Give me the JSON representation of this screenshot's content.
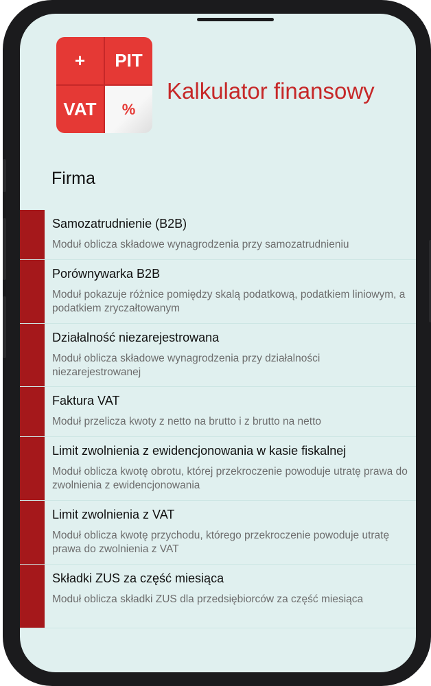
{
  "app": {
    "title": "Kalkulator finansowy",
    "logo": {
      "top_left": "+",
      "top_right": "PIT",
      "bottom_left": "VAT",
      "bottom_right": "%"
    }
  },
  "section": {
    "title": "Firma"
  },
  "items": [
    {
      "title": "Samozatrudnienie (B2B)",
      "description": "Moduł oblicza składowe wynagrodzenia przy samozatrudnieniu"
    },
    {
      "title": "Porównywarka B2B",
      "description": "Moduł pokazuje różnice pomiędzy skalą podatkową, podatkiem liniowym, a podatkiem zryczałtowanym"
    },
    {
      "title": "Działalność niezarejestrowana",
      "description": "Moduł oblicza składowe wynagrodzenia przy działalności niezarejestrowanej"
    },
    {
      "title": "Faktura VAT",
      "description": "Moduł przelicza kwoty z netto na brutto i z brutto na netto"
    },
    {
      "title": "Limit zwolnienia z ewidencjonowania w kasie fiskalnej",
      "description": "Moduł oblicza kwotę obrotu, której przekroczenie powoduje utratę prawa do zwolnienia z ewidencjonowania"
    },
    {
      "title": "Limit zwolnienia z VAT",
      "description": "Moduł oblicza kwotę przychodu, którego przekroczenie powoduje utratę prawa do zwolnienia z VAT"
    },
    {
      "title": "Składki ZUS za część miesiąca",
      "description": "Moduł oblicza składki ZUS dla przedsiębiorców za część miesiąca"
    }
  ],
  "colors": {
    "accent": "#c62828",
    "item_bar": "#a5181b",
    "background": "#e0f0ef"
  }
}
